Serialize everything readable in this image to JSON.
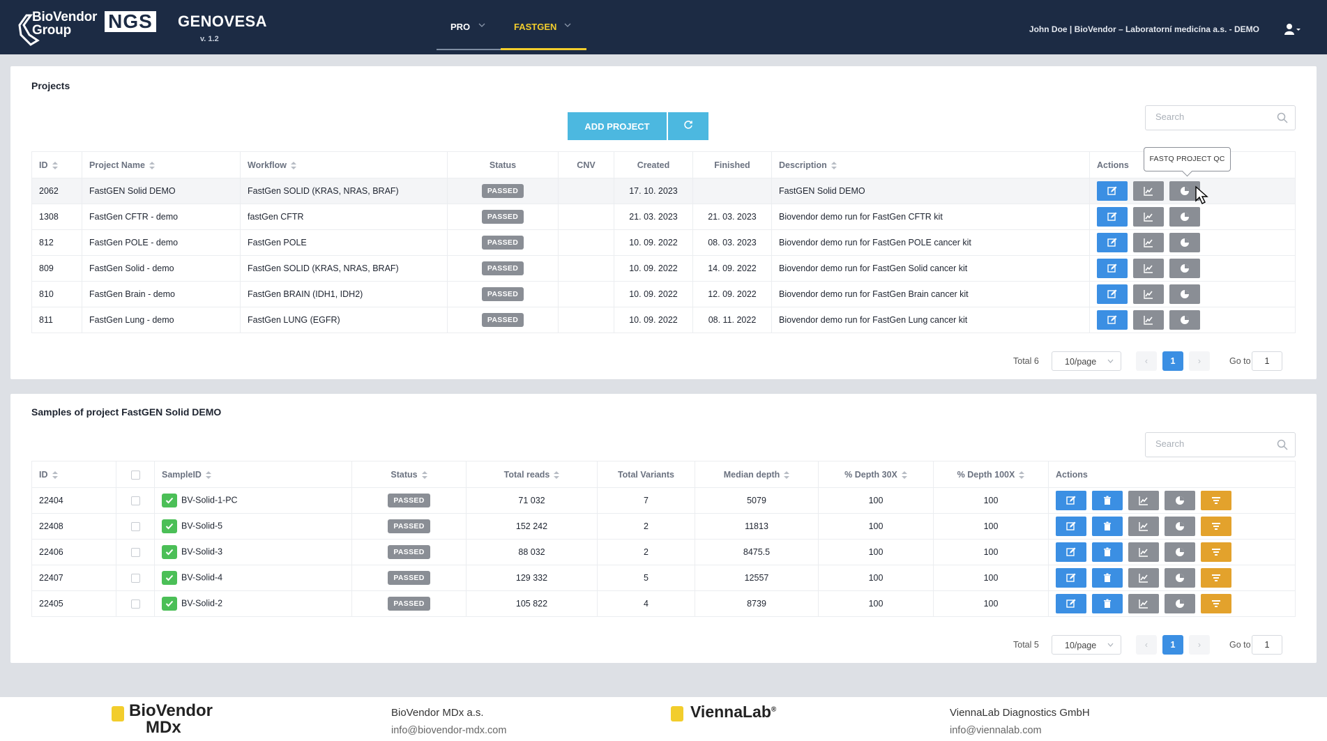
{
  "header": {
    "brand_text": "BioVendor\nGroup",
    "ngs_label": "NGS",
    "app_name": "GENOVESA",
    "version": "v. 1.2",
    "nav": [
      {
        "label": "PRO"
      },
      {
        "label": "FASTGEN"
      }
    ],
    "user_info": "John Doe | BioVendor – Laboratorní medicína a.s. - DEMO"
  },
  "projects": {
    "title": "Projects",
    "add_button": "ADD PROJECT",
    "search_placeholder": "Search",
    "columns": [
      "ID",
      "Project Name",
      "Workflow",
      "Status",
      "CNV",
      "Created",
      "Finished",
      "Description",
      "Actions"
    ],
    "rows": [
      {
        "id": "2062",
        "name": "FastGEN Solid DEMO",
        "workflow": "FastGen SOLID (KRAS, NRAS, BRAF)",
        "status": "PASSED",
        "cnv": "",
        "created": "17. 10. 2023",
        "finished": "",
        "description": "FastGEN Solid DEMO"
      },
      {
        "id": "1308",
        "name": "FastGen CFTR - demo",
        "workflow": "fastGen CFTR",
        "status": "PASSED",
        "cnv": "",
        "created": "21. 03. 2023",
        "finished": "21. 03. 2023",
        "description": "Biovendor demo run for FastGen CFTR kit"
      },
      {
        "id": "812",
        "name": "FastGen POLE - demo",
        "workflow": "FastGen POLE",
        "status": "PASSED",
        "cnv": "",
        "created": "10. 09. 2022",
        "finished": "08. 03. 2023",
        "description": "Biovendor demo run for FastGen POLE cancer kit"
      },
      {
        "id": "809",
        "name": "FastGen Solid - demo",
        "workflow": "FastGen SOLID (KRAS, NRAS, BRAF)",
        "status": "PASSED",
        "cnv": "",
        "created": "10. 09. 2022",
        "finished": "14. 09. 2022",
        "description": "Biovendor demo run for FastGen Solid cancer kit"
      },
      {
        "id": "810",
        "name": "FastGen Brain - demo",
        "workflow": "FastGen BRAIN (IDH1, IDH2)",
        "status": "PASSED",
        "cnv": "",
        "created": "10. 09. 2022",
        "finished": "12. 09. 2022",
        "description": "Biovendor demo run for FastGen Brain cancer kit"
      },
      {
        "id": "811",
        "name": "FastGen Lung - demo",
        "workflow": "FastGen LUNG (EGFR)",
        "status": "PASSED",
        "cnv": "",
        "created": "10. 09. 2022",
        "finished": "08. 11. 2022",
        "description": "Biovendor demo run for FastGen Lung cancer kit"
      }
    ],
    "tooltip": "FASTQ PROJECT QC",
    "pagination": {
      "total": "Total 6",
      "page_size": "10/page",
      "current": "1",
      "goto_label": "Go to",
      "goto_value": "1"
    }
  },
  "samples": {
    "title": "Samples of project FastGEN Solid DEMO",
    "search_placeholder": "Search",
    "columns": [
      "ID",
      "",
      "SampleID",
      "Status",
      "Total reads",
      "Total Variants",
      "Median depth",
      "% Depth 30X",
      "% Depth 100X",
      "Actions"
    ],
    "rows": [
      {
        "id": "22404",
        "sample": "BV-Solid-1-PC",
        "status": "PASSED",
        "reads": "71 032",
        "variants": "7",
        "median": "5079",
        "d30": "100",
        "d100": "100"
      },
      {
        "id": "22408",
        "sample": "BV-Solid-5",
        "status": "PASSED",
        "reads": "152 242",
        "variants": "2",
        "median": "11813",
        "d30": "100",
        "d100": "100"
      },
      {
        "id": "22406",
        "sample": "BV-Solid-3",
        "status": "PASSED",
        "reads": "88 032",
        "variants": "2",
        "median": "8475.5",
        "d30": "100",
        "d100": "100"
      },
      {
        "id": "22407",
        "sample": "BV-Solid-4",
        "status": "PASSED",
        "reads": "129 332",
        "variants": "5",
        "median": "12557",
        "d30": "100",
        "d100": "100"
      },
      {
        "id": "22405",
        "sample": "BV-Solid-2",
        "status": "PASSED",
        "reads": "105 822",
        "variants": "4",
        "median": "8739",
        "d30": "100",
        "d100": "100"
      }
    ],
    "pagination": {
      "total": "Total 5",
      "page_size": "10/page",
      "current": "1",
      "goto_label": "Go to",
      "goto_value": "1"
    }
  },
  "footer": {
    "logo1_line1": "BioVendor",
    "logo1_line2": "MDx",
    "company1": "BioVendor MDx a.s.",
    "email1": "info@biovendor-mdx.com",
    "logo2": "ViennaLab",
    "company2": "ViennaLab Diagnostics GmbH",
    "email2": "info@viennalab.com"
  },
  "colors": {
    "header_bg": "#1c2b44",
    "accent_yellow": "#f2cd2c",
    "button_blue": "#3b8fe3",
    "add_button": "#4cb8e0",
    "status_grey": "#8a8e95",
    "action_orange": "#e3a22c",
    "ok_green": "#4bbf57"
  },
  "icons": [
    "edit-icon",
    "chart-icon",
    "qc-pie-icon",
    "delete-icon",
    "filter-icon",
    "refresh-icon",
    "search-icon",
    "user-icon",
    "check-icon"
  ]
}
